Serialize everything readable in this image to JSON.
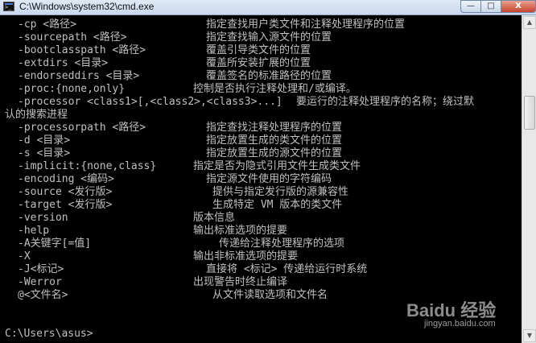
{
  "window": {
    "title": "C:\\Windows\\system32\\cmd.exe",
    "controls": {
      "minimize": "—",
      "maximize": "□",
      "close": "X"
    }
  },
  "console": {
    "options": [
      {
        "option": "-cp <路径>",
        "description": "指定查找用户类文件和注释处理程序的位置"
      },
      {
        "option": "-sourcepath <路径>",
        "description": "指定查找输入源文件的位置"
      },
      {
        "option": "-bootclasspath <路径>",
        "description": "覆盖引导类文件的位置"
      },
      {
        "option": "-extdirs <目录>",
        "description": "覆盖所安装扩展的位置"
      },
      {
        "option": "-endorseddirs <目录>",
        "description": "覆盖签名的标准路径的位置"
      },
      {
        "option": "-proc:{none,only}",
        "description": "控制是否执行注释处理和/或编译。"
      },
      {
        "option": "-processor <class1>[,<class2>,<class3>...]",
        "description": "要运行的注释处理程序的名称；绕过默"
      },
      {
        "option": "认的搜索进程",
        "description": ""
      },
      {
        "option": "-processorpath <路径>",
        "description": "指定查找注释处理程序的位置"
      },
      {
        "option": "-d <目录>",
        "description": "指定放置生成的类文件的位置"
      },
      {
        "option": "-s <目录>",
        "description": "指定放置生成的源文件的位置"
      },
      {
        "option": "-implicit:{none,class}",
        "description": "指定是否为隐式引用文件生成类文件"
      },
      {
        "option": "-encoding <编码>",
        "description": "指定源文件使用的字符编码"
      },
      {
        "option": "-source <发行版>",
        "description": "提供与指定发行版的源兼容性"
      },
      {
        "option": "-target <发行版>",
        "description": "生成特定 VM 版本的类文件"
      },
      {
        "option": "-version",
        "description": "版本信息"
      },
      {
        "option": "-help",
        "description": "输出标准选项的提要"
      },
      {
        "option": "-A关键字[=值]",
        "description": "传递给注释处理程序的选项"
      },
      {
        "option": "-X",
        "description": "输出非标准选项的提要"
      },
      {
        "option": "-J<标记>",
        "description": "直接将 <标记> 传递给运行时系统"
      },
      {
        "option": "-Werror",
        "description": "出现警告时终止编译"
      },
      {
        "option": "@<文件名>",
        "description": "从文件读取选项和文件名"
      }
    ],
    "prompt": "C:\\Users\\asus>"
  },
  "scrollbar": {
    "up": "▲",
    "down": "▼"
  },
  "watermark": {
    "logo": "Baidu 经验",
    "url": "jingyan.baidu.com"
  }
}
